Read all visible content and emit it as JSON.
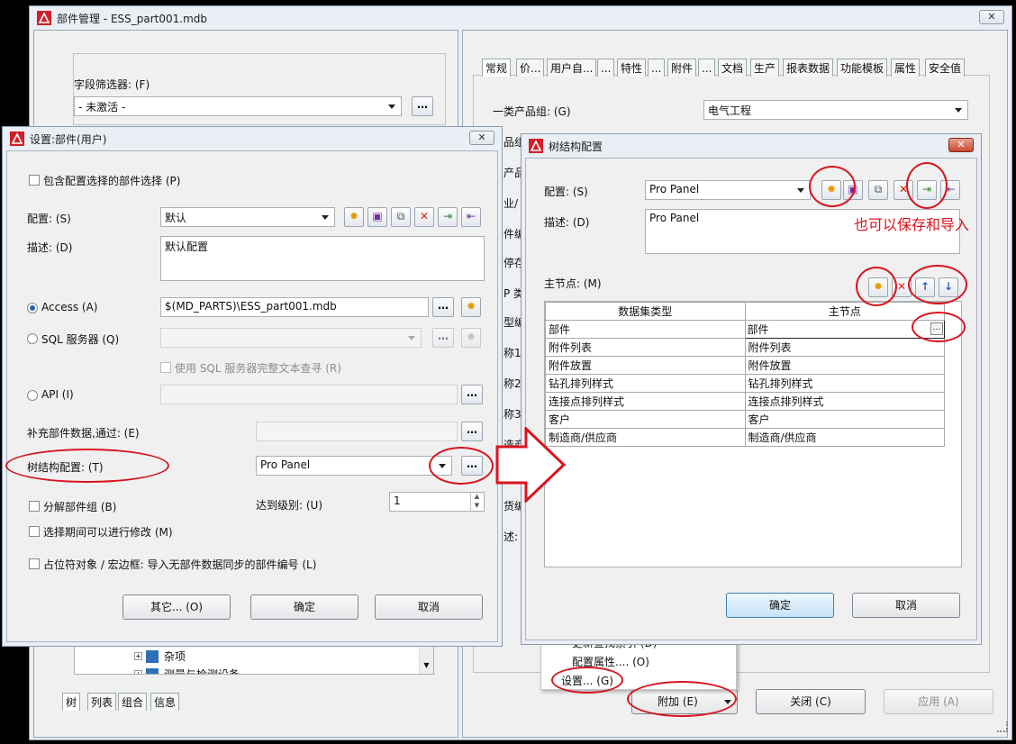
{
  "main_window": {
    "title": "部件管理 - ESS_part001.mdb",
    "field_filter_label": "字段筛选器: (F)",
    "field_filter_value": "- 未激活 -",
    "tree_items": [
      "杂项",
      "测量与检测设备"
    ],
    "bottom_tabs": [
      "树",
      "列表",
      "组合",
      "信息"
    ],
    "right_tabs": [
      "常规",
      "价...",
      "用户自...",
      "...",
      "特性",
      "...",
      "附件",
      "...",
      "文档",
      "生产",
      "报表数据",
      "功能模板",
      "属性",
      "安全值"
    ],
    "product_group_label": "一类产品组: (G)",
    "product_group_value": "电气工程",
    "partial_labels": [
      "品组",
      "产品",
      "业/",
      "件编",
      "停存",
      "P 类",
      "型编",
      "称1",
      "称2",
      "称3",
      "造商",
      "应商",
      "货编",
      "述:"
    ],
    "buttons": {
      "extra": "附加 (E)",
      "close": "关闭 (C)",
      "apply": "应用 (A)"
    }
  },
  "context_menu": {
    "items": [
      "更新查找索引 (D)",
      "配置属性.... (O)",
      "设置... (G)"
    ]
  },
  "settings_dialog": {
    "title": "设置:部件(用户)",
    "include_config_selection": "包含配置选择的部件选择 (P)",
    "config_label": "配置: (S)",
    "config_value": "默认",
    "desc_label": "描述: (D)",
    "desc_value": "默认配置",
    "access_label": "Access (A)",
    "access_value": "$(MD_PARTS)\\ESS_part001.mdb",
    "sql_label": "SQL 服务器 (Q)",
    "sql_fulltext": "使用 SQL 服务器完整文本查寻 (R)",
    "api_label": "API (I)",
    "supplement_label": "补充部件数据,通过: (E)",
    "tree_config_label": "树结构配置: (T)",
    "tree_config_value": "Pro Panel",
    "decompose_label": "分解部件组 (B)",
    "level_label": "达到级别: (U)",
    "level_value": "1",
    "modify_label": "选择期间可以进行修改 (M)",
    "placeholder_label": "占位符对象 / 宏边框: 导入无部件数据同步的部件编号 (L)",
    "buttons": {
      "other": "其它... (O)",
      "ok": "确定",
      "cancel": "取消"
    }
  },
  "tree_dialog": {
    "title": "树结构配置",
    "config_label": "配置: (S)",
    "config_value": "Pro Panel",
    "desc_label": "描述: (D)",
    "desc_value": "Pro Panel",
    "main_node_label": "主节点: (M)",
    "table": {
      "headers": [
        "数据集类型",
        "主节点"
      ],
      "rows": [
        [
          "部件",
          "部件"
        ],
        [
          "附件列表",
          "附件列表"
        ],
        [
          "附件放置",
          "附件放置"
        ],
        [
          "钻孔排列样式",
          "钻孔排列样式"
        ],
        [
          "连接点排列样式",
          "连接点排列样式"
        ],
        [
          "客户",
          "客户"
        ],
        [
          "制造商/供应商",
          "制造商/供应商"
        ]
      ]
    },
    "buttons": {
      "ok": "确定",
      "cancel": "取消"
    }
  },
  "annotation": {
    "text": "也可以保存和导入",
    "color": "#d9141e"
  }
}
